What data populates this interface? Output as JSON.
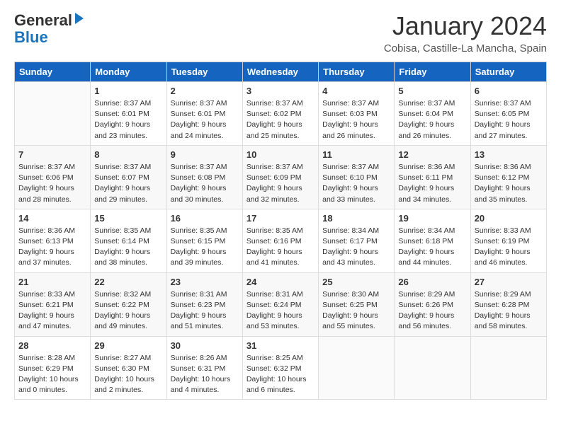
{
  "header": {
    "logo_line1": "General",
    "logo_line2": "Blue",
    "month_title": "January 2024",
    "location": "Cobisa, Castille-La Mancha, Spain"
  },
  "days_of_week": [
    "Sunday",
    "Monday",
    "Tuesday",
    "Wednesday",
    "Thursday",
    "Friday",
    "Saturday"
  ],
  "weeks": [
    [
      {
        "day": "",
        "sunrise": "",
        "sunset": "",
        "daylight": ""
      },
      {
        "day": "1",
        "sunrise": "Sunrise: 8:37 AM",
        "sunset": "Sunset: 6:01 PM",
        "daylight": "Daylight: 9 hours and 23 minutes."
      },
      {
        "day": "2",
        "sunrise": "Sunrise: 8:37 AM",
        "sunset": "Sunset: 6:01 PM",
        "daylight": "Daylight: 9 hours and 24 minutes."
      },
      {
        "day": "3",
        "sunrise": "Sunrise: 8:37 AM",
        "sunset": "Sunset: 6:02 PM",
        "daylight": "Daylight: 9 hours and 25 minutes."
      },
      {
        "day": "4",
        "sunrise": "Sunrise: 8:37 AM",
        "sunset": "Sunset: 6:03 PM",
        "daylight": "Daylight: 9 hours and 26 minutes."
      },
      {
        "day": "5",
        "sunrise": "Sunrise: 8:37 AM",
        "sunset": "Sunset: 6:04 PM",
        "daylight": "Daylight: 9 hours and 26 minutes."
      },
      {
        "day": "6",
        "sunrise": "Sunrise: 8:37 AM",
        "sunset": "Sunset: 6:05 PM",
        "daylight": "Daylight: 9 hours and 27 minutes."
      }
    ],
    [
      {
        "day": "7",
        "sunrise": "Sunrise: 8:37 AM",
        "sunset": "Sunset: 6:06 PM",
        "daylight": "Daylight: 9 hours and 28 minutes."
      },
      {
        "day": "8",
        "sunrise": "Sunrise: 8:37 AM",
        "sunset": "Sunset: 6:07 PM",
        "daylight": "Daylight: 9 hours and 29 minutes."
      },
      {
        "day": "9",
        "sunrise": "Sunrise: 8:37 AM",
        "sunset": "Sunset: 6:08 PM",
        "daylight": "Daylight: 9 hours and 30 minutes."
      },
      {
        "day": "10",
        "sunrise": "Sunrise: 8:37 AM",
        "sunset": "Sunset: 6:09 PM",
        "daylight": "Daylight: 9 hours and 32 minutes."
      },
      {
        "day": "11",
        "sunrise": "Sunrise: 8:37 AM",
        "sunset": "Sunset: 6:10 PM",
        "daylight": "Daylight: 9 hours and 33 minutes."
      },
      {
        "day": "12",
        "sunrise": "Sunrise: 8:36 AM",
        "sunset": "Sunset: 6:11 PM",
        "daylight": "Daylight: 9 hours and 34 minutes."
      },
      {
        "day": "13",
        "sunrise": "Sunrise: 8:36 AM",
        "sunset": "Sunset: 6:12 PM",
        "daylight": "Daylight: 9 hours and 35 minutes."
      }
    ],
    [
      {
        "day": "14",
        "sunrise": "Sunrise: 8:36 AM",
        "sunset": "Sunset: 6:13 PM",
        "daylight": "Daylight: 9 hours and 37 minutes."
      },
      {
        "day": "15",
        "sunrise": "Sunrise: 8:35 AM",
        "sunset": "Sunset: 6:14 PM",
        "daylight": "Daylight: 9 hours and 38 minutes."
      },
      {
        "day": "16",
        "sunrise": "Sunrise: 8:35 AM",
        "sunset": "Sunset: 6:15 PM",
        "daylight": "Daylight: 9 hours and 39 minutes."
      },
      {
        "day": "17",
        "sunrise": "Sunrise: 8:35 AM",
        "sunset": "Sunset: 6:16 PM",
        "daylight": "Daylight: 9 hours and 41 minutes."
      },
      {
        "day": "18",
        "sunrise": "Sunrise: 8:34 AM",
        "sunset": "Sunset: 6:17 PM",
        "daylight": "Daylight: 9 hours and 43 minutes."
      },
      {
        "day": "19",
        "sunrise": "Sunrise: 8:34 AM",
        "sunset": "Sunset: 6:18 PM",
        "daylight": "Daylight: 9 hours and 44 minutes."
      },
      {
        "day": "20",
        "sunrise": "Sunrise: 8:33 AM",
        "sunset": "Sunset: 6:19 PM",
        "daylight": "Daylight: 9 hours and 46 minutes."
      }
    ],
    [
      {
        "day": "21",
        "sunrise": "Sunrise: 8:33 AM",
        "sunset": "Sunset: 6:21 PM",
        "daylight": "Daylight: 9 hours and 47 minutes."
      },
      {
        "day": "22",
        "sunrise": "Sunrise: 8:32 AM",
        "sunset": "Sunset: 6:22 PM",
        "daylight": "Daylight: 9 hours and 49 minutes."
      },
      {
        "day": "23",
        "sunrise": "Sunrise: 8:31 AM",
        "sunset": "Sunset: 6:23 PM",
        "daylight": "Daylight: 9 hours and 51 minutes."
      },
      {
        "day": "24",
        "sunrise": "Sunrise: 8:31 AM",
        "sunset": "Sunset: 6:24 PM",
        "daylight": "Daylight: 9 hours and 53 minutes."
      },
      {
        "day": "25",
        "sunrise": "Sunrise: 8:30 AM",
        "sunset": "Sunset: 6:25 PM",
        "daylight": "Daylight: 9 hours and 55 minutes."
      },
      {
        "day": "26",
        "sunrise": "Sunrise: 8:29 AM",
        "sunset": "Sunset: 6:26 PM",
        "daylight": "Daylight: 9 hours and 56 minutes."
      },
      {
        "day": "27",
        "sunrise": "Sunrise: 8:29 AM",
        "sunset": "Sunset: 6:28 PM",
        "daylight": "Daylight: 9 hours and 58 minutes."
      }
    ],
    [
      {
        "day": "28",
        "sunrise": "Sunrise: 8:28 AM",
        "sunset": "Sunset: 6:29 PM",
        "daylight": "Daylight: 10 hours and 0 minutes."
      },
      {
        "day": "29",
        "sunrise": "Sunrise: 8:27 AM",
        "sunset": "Sunset: 6:30 PM",
        "daylight": "Daylight: 10 hours and 2 minutes."
      },
      {
        "day": "30",
        "sunrise": "Sunrise: 8:26 AM",
        "sunset": "Sunset: 6:31 PM",
        "daylight": "Daylight: 10 hours and 4 minutes."
      },
      {
        "day": "31",
        "sunrise": "Sunrise: 8:25 AM",
        "sunset": "Sunset: 6:32 PM",
        "daylight": "Daylight: 10 hours and 6 minutes."
      },
      {
        "day": "",
        "sunrise": "",
        "sunset": "",
        "daylight": ""
      },
      {
        "day": "",
        "sunrise": "",
        "sunset": "",
        "daylight": ""
      },
      {
        "day": "",
        "sunrise": "",
        "sunset": "",
        "daylight": ""
      }
    ]
  ]
}
